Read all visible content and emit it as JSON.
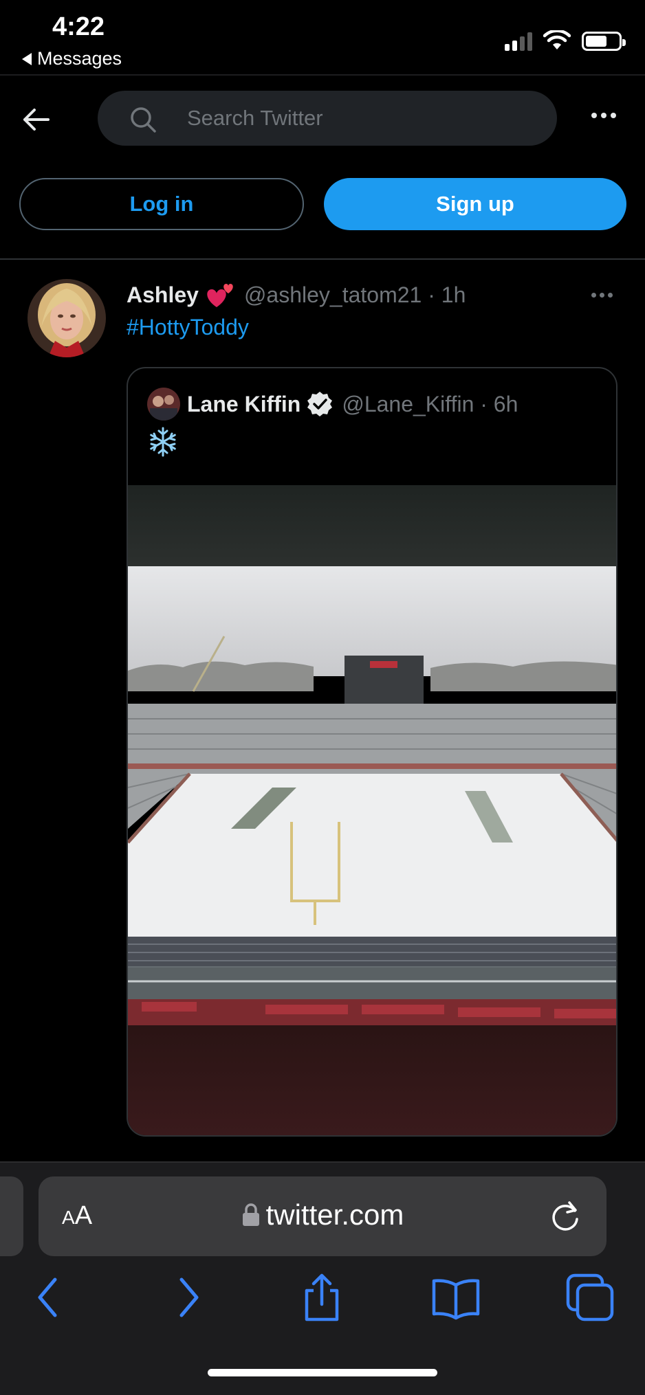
{
  "status_bar": {
    "time": "4:22",
    "back_app": "Messages"
  },
  "header": {
    "search_placeholder": "Search Twitter",
    "icons": [
      "back-arrow-icon",
      "search-icon",
      "more-icon"
    ]
  },
  "auth": {
    "login_label": "Log in",
    "signup_label": "Sign up"
  },
  "tweet": {
    "name": "Ashley",
    "name_emoji": "red-heart-emoji",
    "handle_time": "@ashley_tatom21 · 1h",
    "hashtag": "#HottyToddy",
    "quoted": {
      "name": "Lane Kiffin",
      "verified": true,
      "handle_time": "@Lane_Kiffin · 6h",
      "text_emoji": "snowflake-emoji",
      "media_description_icon": "snow-covered-stadium-photo"
    }
  },
  "safari": {
    "text_size_small": "A",
    "text_size_big": "A",
    "url": "twitter.com",
    "icons": [
      "back-chevron-icon",
      "forward-chevron-icon",
      "share-icon",
      "bookmarks-icon",
      "tabs-icon",
      "reload-icon",
      "lock-icon"
    ]
  },
  "colors": {
    "accent": "#1d9bf0",
    "background": "#000000",
    "secondary_text": "#71767b",
    "safari_accent": "#3a82f7"
  }
}
